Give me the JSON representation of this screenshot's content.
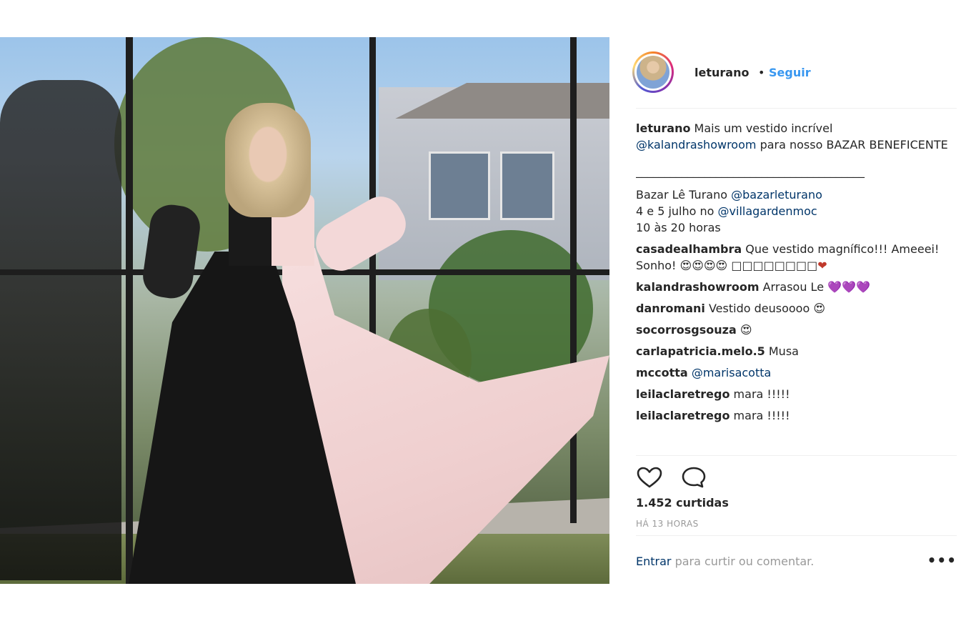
{
  "post": {
    "image_alt": "Photo of a woman in a black and pink off-shoulder gown in front of a glass wall"
  },
  "header": {
    "username": "leturano",
    "separator": "•",
    "follow_label": "Seguir"
  },
  "caption": {
    "user": "leturano",
    "text_1": "Mais um vestido incrível",
    "mention_1": "@kalandrashowroom",
    "text_2": "para nosso BAZAR BENEFICENTE",
    "rule": "________________________________________",
    "line_1_text": "Bazar Lê Turano",
    "line_1_mention": "@bazarleturano",
    "line_2_text": "4 e 5 julho no",
    "line_2_mention": "@villagardenmoc",
    "line_3": "10 às 20 horas"
  },
  "comments": [
    {
      "user": "casadealhambra",
      "text": "Que vestido magnífico!!! Ameeei! Sonho! 😍😍😍😍 □□□□□□□□"
    },
    {
      "user": "kalandrashowroom",
      "text": "Arrasou Le"
    },
    {
      "user": "danromani",
      "text": "Vestido deusoooo 😍"
    },
    {
      "user": "socorrosgsouza",
      "text": "😍"
    },
    {
      "user": "carlapatricia.melo.5",
      "text": "Musa"
    },
    {
      "user": "mccotta",
      "mention": "@marisacotta"
    },
    {
      "user": "leilaclaretrego",
      "text": "mara !!!!!"
    },
    {
      "user": "leilaclaretrego",
      "text": "mara !!!!!"
    }
  ],
  "comment_hearts": {
    "purple": "💜💜💜",
    "red": "❤"
  },
  "actions": {
    "like_icon": "heart-icon",
    "comment_icon": "comment-bubble-icon",
    "likes": "1.452 curtidas",
    "time": "HÁ 13 HORAS"
  },
  "footer": {
    "login_link": "Entrar",
    "login_rest": "para curtir ou comentar.",
    "more": "•••"
  },
  "colors": {
    "link_blue": "#3897f0",
    "mention_blue": "#003569",
    "text": "#262626",
    "muted": "#999999"
  }
}
